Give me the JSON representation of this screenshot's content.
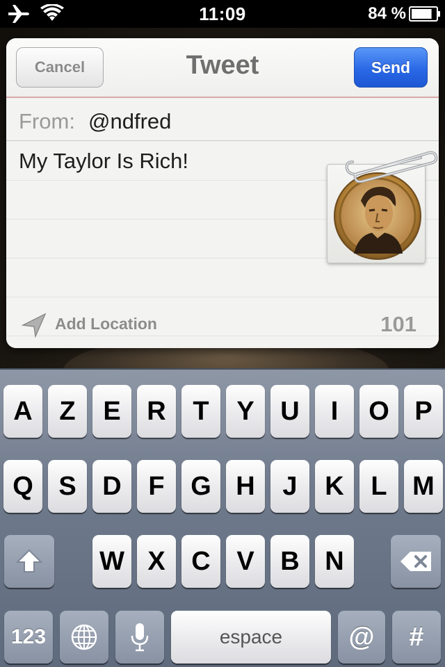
{
  "status_bar": {
    "time": "11:09",
    "battery_text": "84 %",
    "battery_level": 0.84,
    "icons": [
      "airplane-icon",
      "wifi-icon",
      "battery-icon"
    ]
  },
  "sheet": {
    "title": "Tweet",
    "cancel_label": "Cancel",
    "send_label": "Send",
    "from_label": "From:",
    "from_value": "@ndfred",
    "tweet_text": "My Taylor Is Rich!",
    "add_location_label": "Add Location",
    "char_count": "101",
    "accent_color": "#2a68e6"
  },
  "keyboard": {
    "row1": [
      "A",
      "Z",
      "E",
      "R",
      "T",
      "Y",
      "U",
      "I",
      "O",
      "P"
    ],
    "row2": [
      "Q",
      "S",
      "D",
      "F",
      "G",
      "H",
      "J",
      "K",
      "L",
      "M"
    ],
    "row3": [
      "W",
      "X",
      "C",
      "V",
      "B",
      "N"
    ],
    "numbers_label": "123",
    "space_label": "espace",
    "at_label": "@",
    "hash_label": "#"
  }
}
